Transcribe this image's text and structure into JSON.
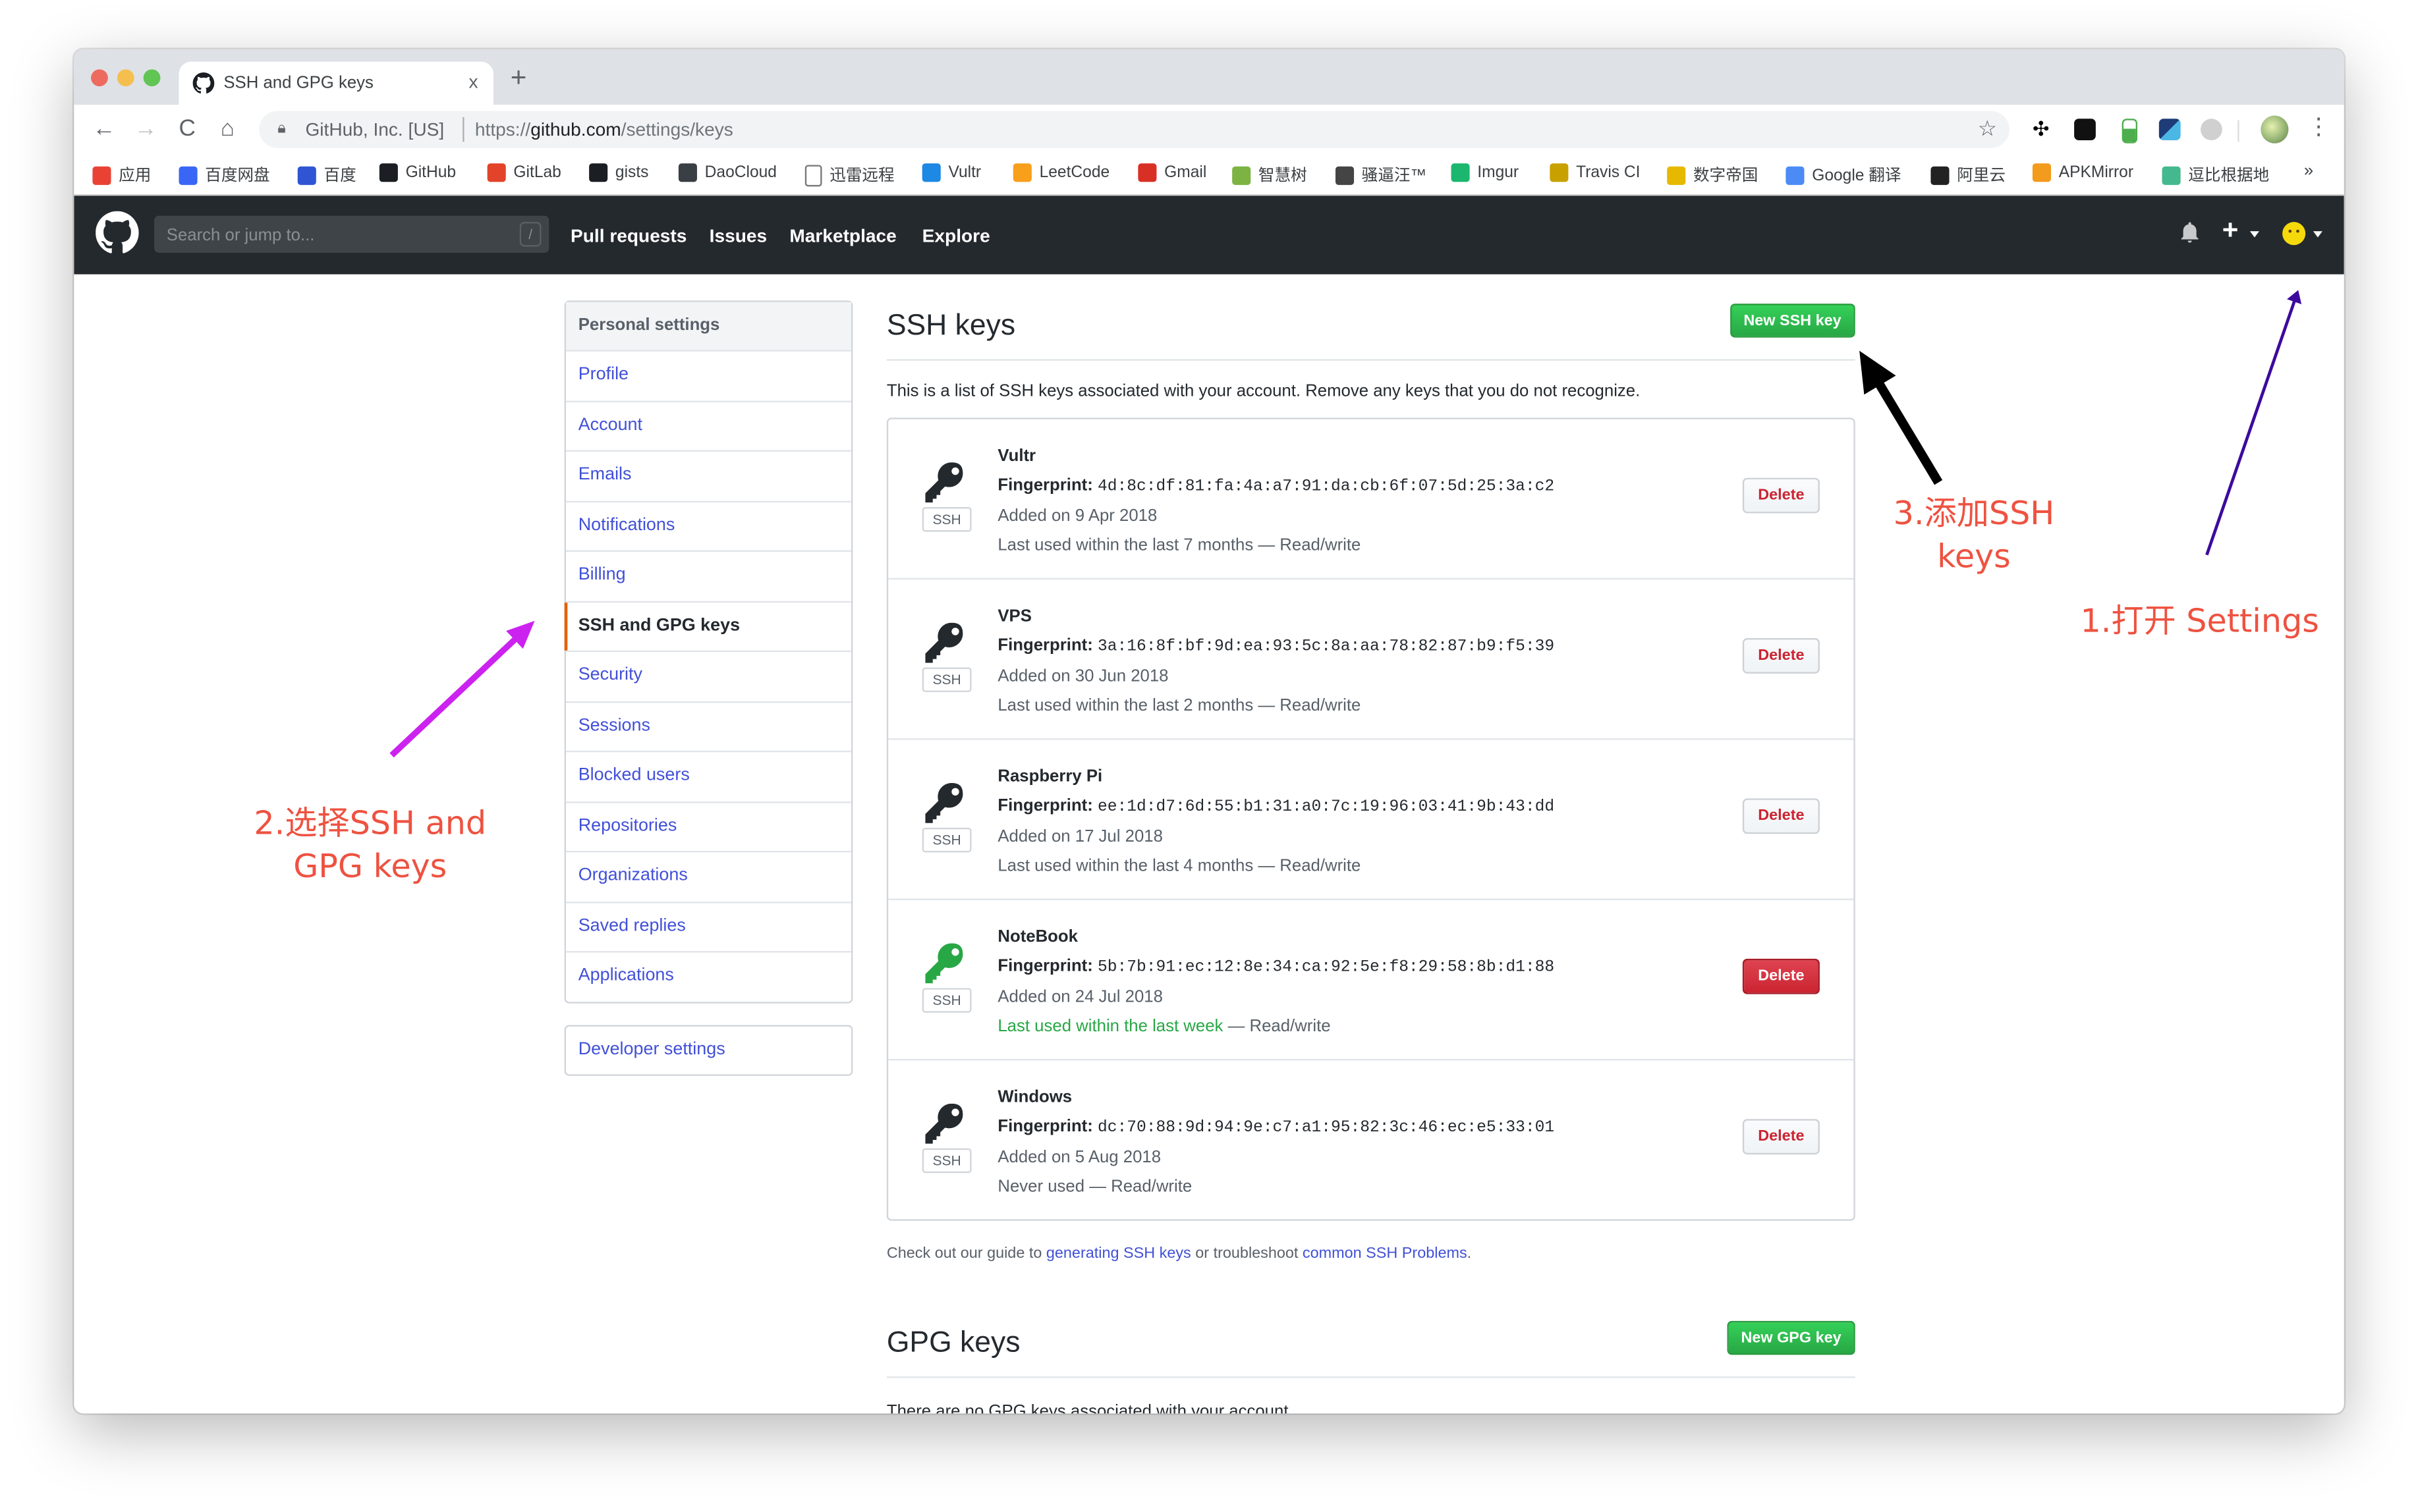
{
  "browser": {
    "tab_title": "SSH and GPG keys",
    "tab_close": "x",
    "new_tab": "+",
    "nav": {
      "back": "←",
      "forward": "→",
      "reload": "C",
      "home": "⌂"
    },
    "omnibox": {
      "org": "GitHub, Inc. [US]",
      "url_scheme": "https://",
      "url_host": "github.com",
      "url_path": "/settings/keys"
    },
    "extensions": [
      "gnome-foot",
      "tampermonkey",
      "download",
      "translate",
      "hexagon"
    ],
    "bookmarks": [
      {
        "label": "应用",
        "icon": "apps-grid",
        "color": "#e94235"
      },
      {
        "label": "百度网盘",
        "icon": "baidu-pan",
        "color": "#3a66f5"
      },
      {
        "label": "百度",
        "icon": "baidu-paw",
        "color": "#2f55d4"
      },
      {
        "label": "GitHub",
        "icon": "github",
        "color": "#1b1f23"
      },
      {
        "label": "GitLab",
        "icon": "gitlab",
        "color": "#e2432a"
      },
      {
        "label": "gists",
        "icon": "github",
        "color": "#1b1f23"
      },
      {
        "label": "DaoCloud",
        "icon": "daocloud",
        "color": "#3a3f46"
      },
      {
        "label": "迅雷远程",
        "icon": "page",
        "color": "#ffffff"
      },
      {
        "label": "Vultr",
        "icon": "vultr",
        "color": "#1e88e5"
      },
      {
        "label": "LeetCode",
        "icon": "leetcode",
        "color": "#f89f1b"
      },
      {
        "label": "Gmail",
        "icon": "gmail",
        "color": "#d93025"
      },
      {
        "label": "智慧树",
        "icon": "zhihuishu",
        "color": "#7cb342"
      },
      {
        "label": "骚逼汪™",
        "icon": "s-circle",
        "color": "#444444"
      },
      {
        "label": "Imgur",
        "icon": "imgur",
        "color": "#1bb76e"
      },
      {
        "label": "Travis CI",
        "icon": "travis",
        "color": "#c8a100"
      },
      {
        "label": "数字帝国",
        "icon": "pi",
        "color": "#e6b800"
      },
      {
        "label": "Google 翻译",
        "icon": "google-translate",
        "color": "#4c8bf5"
      },
      {
        "label": "阿里云",
        "icon": "aliyun",
        "color": "#222222"
      },
      {
        "label": "APKMirror",
        "icon": "apkmirror",
        "color": "#f29b1d"
      },
      {
        "label": "逗比根据地",
        "icon": "s-circle",
        "color": "#45b98e"
      }
    ],
    "bookmarks_more": "»"
  },
  "github_header": {
    "search_placeholder": "Search or jump to...",
    "search_shortcut": "/",
    "nav": [
      "Pull requests",
      "Issues",
      "Marketplace",
      "Explore"
    ],
    "plus": "+"
  },
  "sidebar": {
    "heading": "Personal settings",
    "items": [
      {
        "label": "Profile",
        "selected": false
      },
      {
        "label": "Account",
        "selected": false
      },
      {
        "label": "Emails",
        "selected": false
      },
      {
        "label": "Notifications",
        "selected": false
      },
      {
        "label": "Billing",
        "selected": false
      },
      {
        "label": "SSH and GPG keys",
        "selected": true
      },
      {
        "label": "Security",
        "selected": false
      },
      {
        "label": "Sessions",
        "selected": false
      },
      {
        "label": "Blocked users",
        "selected": false
      },
      {
        "label": "Repositories",
        "selected": false
      },
      {
        "label": "Organizations",
        "selected": false
      },
      {
        "label": "Saved replies",
        "selected": false
      },
      {
        "label": "Applications",
        "selected": false
      }
    ],
    "developer_settings": "Developer settings"
  },
  "ssh": {
    "title": "SSH keys",
    "new_button": "New SSH key",
    "intro": "This is a list of SSH keys associated with your account. Remove any keys that you do not recognize.",
    "fingerprint_label": "Fingerprint:",
    "type_label": "SSH",
    "delete_label": "Delete",
    "keys": [
      {
        "title": "Vultr",
        "fingerprint": "4d:8c:df:81:fa:4a:a7:91:da:cb:6f:07:5d:25:3a:c2",
        "added": "Added on 9 Apr 2018",
        "last_used": "Last used within the last 7 months",
        "access": " — Read/write",
        "recent": false,
        "delete_active": false
      },
      {
        "title": "VPS",
        "fingerprint": "3a:16:8f:bf:9d:ea:93:5c:8a:aa:78:82:87:b9:f5:39",
        "added": "Added on 30 Jun 2018",
        "last_used": "Last used within the last 2 months",
        "access": " — Read/write",
        "recent": false,
        "delete_active": false
      },
      {
        "title": "Raspberry Pi",
        "fingerprint": "ee:1d:d7:6d:55:b1:31:a0:7c:19:96:03:41:9b:43:dd",
        "added": "Added on 17 Jul 2018",
        "last_used": "Last used within the last 4 months",
        "access": " — Read/write",
        "recent": false,
        "delete_active": false
      },
      {
        "title": "NoteBook",
        "fingerprint": "5b:7b:91:ec:12:8e:34:ca:92:5e:f8:29:58:8b:d1:88",
        "added": "Added on 24 Jul 2018",
        "last_used": "Last used within the last week",
        "access": " — Read/write",
        "recent": true,
        "delete_active": true
      },
      {
        "title": "Windows",
        "fingerprint": "dc:70:88:9d:94:9e:c7:a1:95:82:3c:46:ec:e5:33:01",
        "added": "Added on 5 Aug 2018",
        "last_used": "Never used",
        "access": " — Read/write",
        "recent": false,
        "delete_active": false
      }
    ],
    "help_prefix": "Check out our guide to ",
    "help_link1": "generating SSH keys",
    "help_middle": " or troubleshoot ",
    "help_link2": "common SSH Problems",
    "help_suffix": "."
  },
  "gpg": {
    "title": "GPG keys",
    "new_button": "New GPG key",
    "empty_text": "There are no GPG keys associated with your account."
  },
  "annotations": {
    "step1": "1.打开 Settings",
    "step2_line1": "2.选择SSH and",
    "step2_line2": "GPG keys",
    "step3_line1": "3.添加SSH",
    "step3_line2": "keys",
    "colors": {
      "text": "#ee5241",
      "arrow1": "#3d0a9e",
      "arrow2": "#cc22f0",
      "arrow3": "#000000"
    }
  },
  "colors": {
    "link": "#4150d8",
    "primary_green": "#2ea44f",
    "danger": "#cb2431",
    "header_bg": "#24292e",
    "selected_accent": "#e36209",
    "recent_green": "#28a745"
  }
}
